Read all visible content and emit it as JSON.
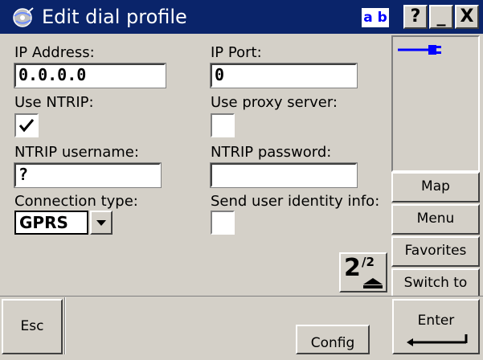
{
  "window": {
    "title": "Edit dial profile",
    "input_mode": "a b",
    "help_label": "?",
    "minimize_label": "_",
    "close_label": "X"
  },
  "form": {
    "ip_address": {
      "label": "IP Address:",
      "value": "0.0.0.0"
    },
    "ip_port": {
      "label": "IP Port:",
      "value": "0"
    },
    "use_ntrip": {
      "label": "Use NTRIP:",
      "checked": true
    },
    "use_proxy": {
      "label": "Use proxy server:",
      "checked": false
    },
    "ntrip_username": {
      "label": "NTRIP username:",
      "value": "?"
    },
    "ntrip_password": {
      "label": "NTRIP password:",
      "value": ""
    },
    "connection_type": {
      "label": "Connection type:",
      "value": "GPRS"
    },
    "send_identity": {
      "label": "Send user identity info:",
      "checked": false
    }
  },
  "pagination": {
    "current": "2",
    "total": "/2"
  },
  "right_panel": {
    "status_icon": "power-plug-icon",
    "buttons": [
      "Map",
      "Menu",
      "Favorites",
      "Switch to"
    ]
  },
  "bottom": {
    "esc_label": "Esc",
    "config_label": "Config",
    "enter_label": "Enter"
  },
  "colors": {
    "titlebar": "#0a246a",
    "face": "#d4d0c8",
    "accent": "#0000ff"
  }
}
